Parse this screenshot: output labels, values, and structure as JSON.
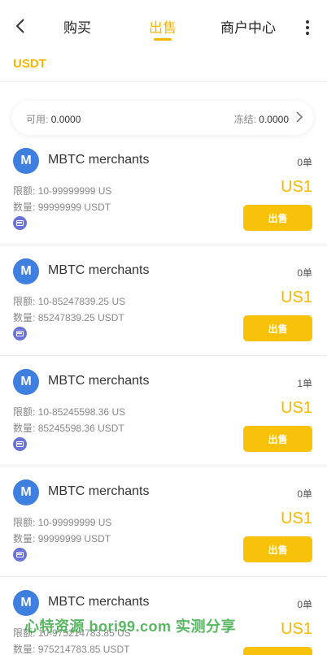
{
  "nav": {
    "tabs": [
      {
        "label": "购买"
      },
      {
        "label": "出售"
      },
      {
        "label": "商户中心"
      }
    ]
  },
  "coin": "USDT",
  "balance": {
    "available_label": "可用:",
    "available_value": "0.0000",
    "frozen_label": "冻结:",
    "frozen_value": "0.0000"
  },
  "merchants": [
    {
      "avatar": "M",
      "name": "MBTC merchants",
      "orders": "0单",
      "limit_label": "限额:",
      "limit": "10-99999999 US",
      "qty_label": "数量:",
      "qty": "99999999 USDT",
      "price": "US1",
      "button": "出售"
    },
    {
      "avatar": "M",
      "name": "MBTC merchants",
      "orders": "0单",
      "limit_label": "限额:",
      "limit": "10-85247839.25 US",
      "qty_label": "数量:",
      "qty": "85247839.25 USDT",
      "price": "US1",
      "button": "出售"
    },
    {
      "avatar": "M",
      "name": "MBTC merchants",
      "orders": "1单",
      "limit_label": "限额:",
      "limit": "10-85245598.36 US",
      "qty_label": "数量:",
      "qty": "85245598.36 USDT",
      "price": "US1",
      "button": "出售"
    },
    {
      "avatar": "M",
      "name": "MBTC merchants",
      "orders": "0单",
      "limit_label": "限额:",
      "limit": "10-99999999 US",
      "qty_label": "数量:",
      "qty": "99999999 USDT",
      "price": "US1",
      "button": "出售"
    },
    {
      "avatar": "M",
      "name": "MBTC merchants",
      "orders": "0单",
      "limit_label": "限额:",
      "limit": "10-975214783.85 US",
      "qty_label": "数量:",
      "qty": "975214783.85 USDT",
      "price": "US1",
      "button": "出售"
    }
  ],
  "watermark": "心特资源 bori99.com 实测分享",
  "colors": {
    "accent": "#f5b800",
    "avatar": "#3f7fe0",
    "pay_icon": "#6a74d8"
  }
}
